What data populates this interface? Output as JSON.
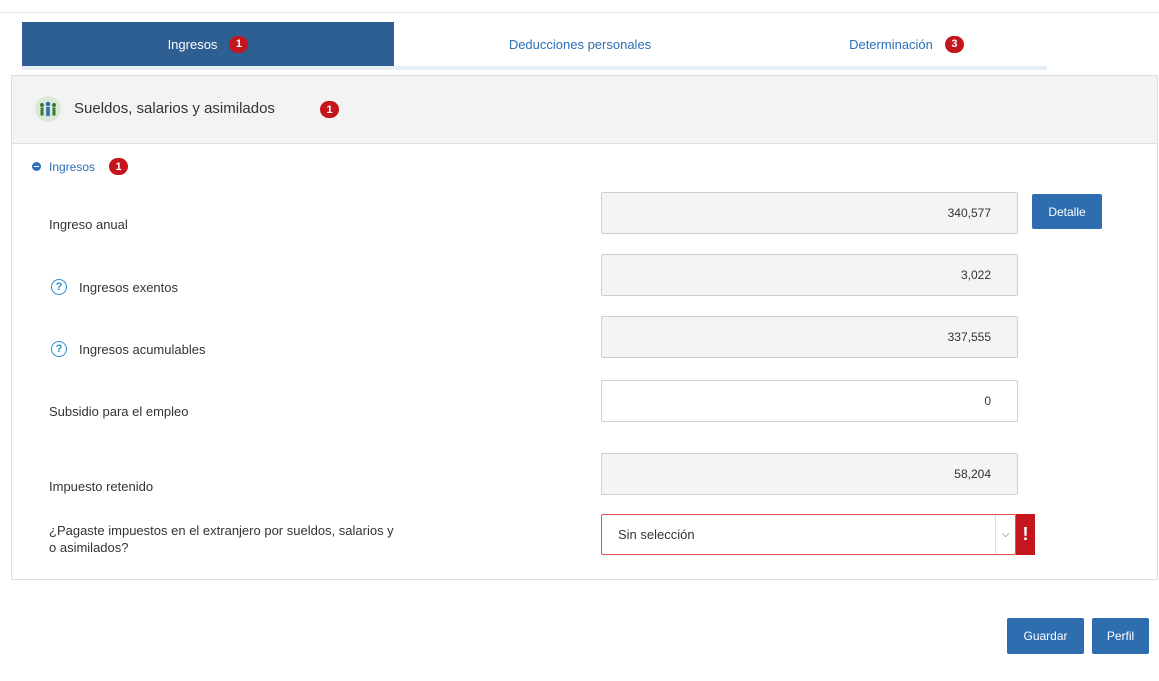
{
  "tabs": [
    {
      "label": "Ingresos",
      "badge": "1"
    },
    {
      "label": "Deducciones personales",
      "badge": ""
    },
    {
      "label": "Determinación",
      "badge": "3"
    }
  ],
  "section": {
    "icon": "people-group-icon",
    "title": "Sueldos, salarios y asimilados",
    "badge": "1"
  },
  "subsection": {
    "label": "Ingresos",
    "badge": "1"
  },
  "fields": {
    "ingreso_anual": {
      "label": "Ingreso anual",
      "value": "340,577"
    },
    "ingresos_exentos": {
      "label": "Ingresos exentos",
      "value": "3,022"
    },
    "ingresos_acumulables": {
      "label": "Ingresos acumulables",
      "value": "337,555"
    },
    "subsidio": {
      "label": "Subsidio para el empleo",
      "value": "0"
    },
    "impuesto_retenido": {
      "label": "Impuesto retenido",
      "value": "58,204"
    }
  },
  "question": {
    "label_line1": "¿Pagaste impuestos en el extranjero por sueldos, salarios y",
    "label_line2": "o asimilados?",
    "selected": "Sin selección",
    "error_mark": "!"
  },
  "buttons": {
    "detail": "Detalle",
    "save": "Guardar",
    "profile": "Perfil"
  },
  "help_glyph": "?",
  "colors": {
    "primary": "#2d6db0",
    "active_tab": "#2d5f93",
    "badge": "#c4161c",
    "link": "#2c6fb6"
  }
}
